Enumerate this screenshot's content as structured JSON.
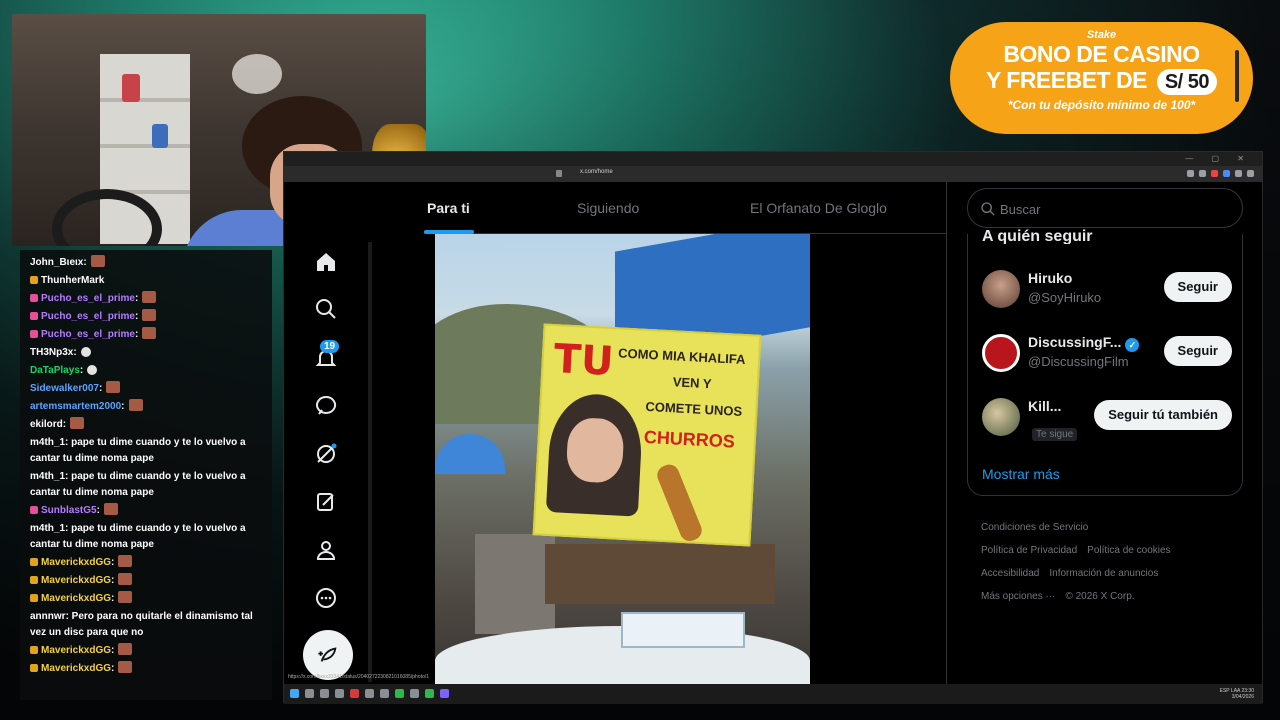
{
  "chat": [
    {
      "user": "John_Bιeιx",
      "text": ":",
      "color": "white",
      "badge": false,
      "multi": false
    },
    {
      "user": "ThunherMark",
      "text": "",
      "color": "white",
      "badge": true,
      "multi": false
    },
    {
      "user": "Pucho_es_el_prime",
      "text": ":",
      "color": "purple",
      "badge": true,
      "multi": false
    },
    {
      "user": "Pucho_es_el_prime",
      "text": ":",
      "color": "purple",
      "badge": true,
      "multi": false
    },
    {
      "user": "Pucho_es_el_prime",
      "text": ":",
      "color": "purple",
      "badge": true,
      "multi": false
    },
    {
      "user": "TH3Np3x",
      "text": ":",
      "color": "white",
      "badge": false,
      "multi": false
    },
    {
      "user": "DaTaPlays",
      "text": ":",
      "color": "green",
      "badge": false,
      "multi": false
    },
    {
      "user": "Sidewalker007",
      "text": ":",
      "color": "blue",
      "badge": false,
      "multi": false
    },
    {
      "user": "artemsmartem2000",
      "text": ":",
      "color": "blue",
      "badge": false,
      "multi": false
    },
    {
      "user": "ekilord",
      "text": ":",
      "color": "white",
      "badge": false,
      "multi": false
    },
    {
      "user": "m4th_1",
      "text": ": pape tu dime cuando y te lo vuelvo a cantar tu dime noma pape",
      "color": "white",
      "badge": false,
      "multi": true
    },
    {
      "user": "m4th_1",
      "text": ": pape tu dime cuando y te lo vuelvo a cantar tu dime noma pape",
      "color": "white",
      "badge": false,
      "multi": true
    },
    {
      "user": "SunblastG5",
      "text": ":",
      "color": "purple",
      "badge": true,
      "multi": false
    },
    {
      "user": "m4th_1",
      "text": ": pape tu dime cuando y te lo vuelvo a cantar tu dime noma pape",
      "color": "white",
      "badge": false,
      "multi": true
    },
    {
      "user": "MaverickxdGG",
      "text": ":",
      "color": "yellow",
      "badge": true,
      "multi": false
    },
    {
      "user": "MaverickxdGG",
      "text": ":",
      "color": "yellow",
      "badge": true,
      "multi": false
    },
    {
      "user": "MaverickxdGG",
      "text": ":",
      "color": "yellow",
      "badge": true,
      "multi": false
    },
    {
      "user": "annnwr",
      "text": ": Pero para no quitarle el dinamismo tal vez un disc para que no",
      "color": "white",
      "badge": false,
      "multi": true
    },
    {
      "user": "MaverickxdGG",
      "text": ":",
      "color": "yellow",
      "badge": true,
      "multi": false
    },
    {
      "user": "MaverickxdGG",
      "text": ":",
      "color": "yellow",
      "badge": true,
      "multi": false
    }
  ],
  "ad": {
    "logo": "Stake",
    "line1": "BONO DE CASINO",
    "line2": "Y FREEBET DE",
    "amount": "S/ 50",
    "sub": "*Con tu depósito mínimo de 100*"
  },
  "browser": {
    "url": "x.com/home",
    "status_url": "https://x.com/bxxx33341/status/2040272230821016085/photo/1",
    "window_controls": "— ▢ ✕"
  },
  "nav": {
    "notif_count": "19",
    "icons": [
      "home-icon",
      "search-icon",
      "notifications-icon",
      "messages-icon",
      "grok-icon",
      "drafts-icon",
      "profile-icon",
      "more-icon",
      "post-icon"
    ]
  },
  "tabs": [
    {
      "label": "Para ti",
      "active": true
    },
    {
      "label": "Siguiendo",
      "active": false
    },
    {
      "label": "El Orfanato De Gloglo",
      "active": false
    }
  ],
  "post_image": {
    "banner_tu": "TU",
    "banner_l1": "COMO MIA KHALIFA",
    "banner_l2": "VEN Y",
    "banner_l3": "COMETE UNOS",
    "banner_l4": "CHURROS"
  },
  "search": {
    "placeholder": "Buscar"
  },
  "who_to_follow": {
    "title": "A quién seguir",
    "accounts": [
      {
        "name": "Hiruko",
        "handle": "@SoyHiruko",
        "button": "Seguir",
        "verified": false,
        "follows_you": ""
      },
      {
        "name": "DiscussingF...",
        "handle": "@DiscussingFilm",
        "button": "Seguir",
        "verified": true,
        "follows_you": ""
      },
      {
        "name": "Kill...",
        "handle": "",
        "button": "Seguir tú también",
        "verified": false,
        "follows_you": "Te sigue"
      }
    ],
    "show_more": "Mostrar más"
  },
  "footer": {
    "links": [
      "Condiciones de Servicio",
      "Política de Privacidad",
      "Política de cookies",
      "Accesibilidad",
      "Información de anuncios",
      "Más opciones ···"
    ],
    "copyright": "© 2026 X Corp."
  },
  "taskbar": {
    "lang": "ESP LAA",
    "time": "23:30",
    "date": "3/04/2026"
  }
}
